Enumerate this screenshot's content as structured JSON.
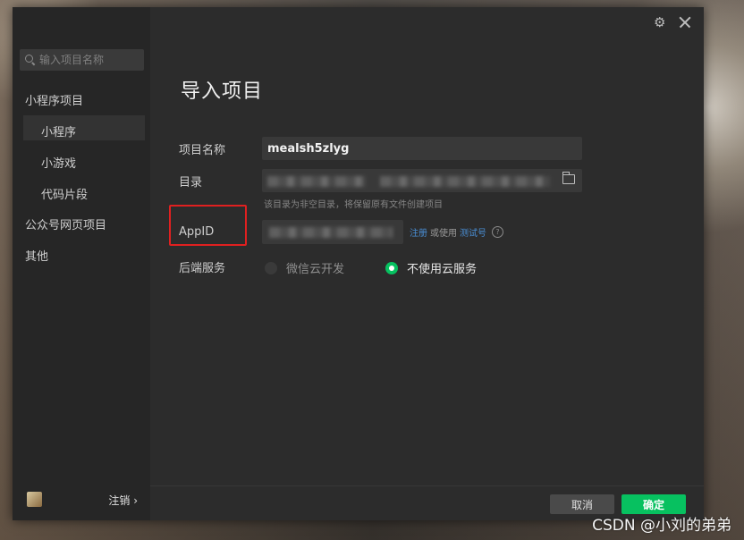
{
  "window": {
    "icons": [
      "gear-icon",
      "close-icon"
    ]
  },
  "sidebar": {
    "search_placeholder": "输入项目名称",
    "items": [
      {
        "label": "小程序项目"
      },
      {
        "label": "小程序"
      },
      {
        "label": "小游戏"
      },
      {
        "label": "代码片段"
      },
      {
        "label": "公众号网页项目"
      },
      {
        "label": "其他"
      }
    ],
    "active_item": "小程序",
    "footer": {
      "logout_label": "注销 ›"
    }
  },
  "main": {
    "title": "导入项目",
    "fields": {
      "project_name_label": "项目名称",
      "project_name_value": "mealsh5zlyg",
      "directory_label": "目录",
      "directory_hint": "该目录为非空目录，将保留原有文件创建项目",
      "appid_label": "AppID",
      "appid_register": "注册",
      "appid_or_use": "或使用",
      "appid_test_account": "测试号",
      "appid_help": "?",
      "backend_label": "后端服务",
      "backend_options": [
        {
          "label": "微信云开发",
          "selected": false
        },
        {
          "label": "不使用云服务",
          "selected": true
        }
      ]
    }
  },
  "footer": {
    "cancel_label": "取消",
    "ok_label": "确定"
  },
  "watermark": "CSDN @小刘的弟弟",
  "colors": {
    "accent_green": "#07c160",
    "link_blue": "#4a8fd6",
    "highlight_red": "#e02020",
    "window_bg": "#2c2c2c",
    "sidebar_bg": "#262626"
  }
}
